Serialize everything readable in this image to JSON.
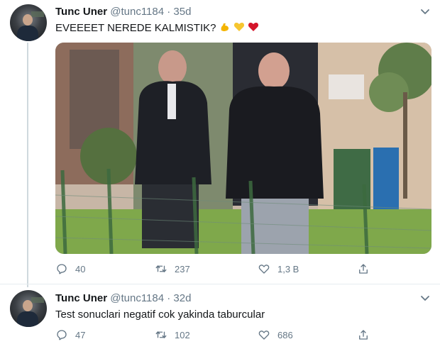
{
  "tweets": [
    {
      "name": "Tunc Uner",
      "handle": "@tunc1184",
      "separator": "·",
      "time": "35d",
      "text": "EVEEEET NEREDE KALMISTIK?",
      "emojis": [
        "flexed-biceps",
        "yellow-heart",
        "red-heart"
      ],
      "has_media": true,
      "replies": "40",
      "retweets": "237",
      "likes": "1,3 B"
    },
    {
      "name": "Tunc Uner",
      "handle": "@tunc1184",
      "separator": "·",
      "time": "32d",
      "text": "Test sonuclari negatif cok yakinda taburcular",
      "replies": "47",
      "retweets": "102",
      "likes": "686"
    }
  ],
  "colors": {
    "text": "#14171a",
    "secondary": "#657786",
    "thread_line": "#cfd9de",
    "divider": "#e6ecf0"
  }
}
